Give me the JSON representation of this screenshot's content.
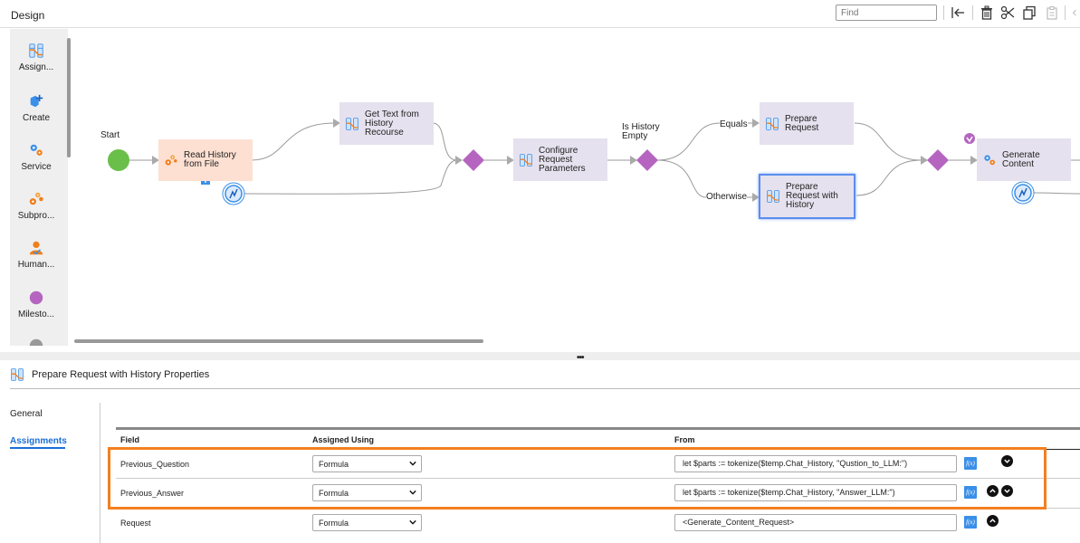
{
  "header": {
    "title": "Design",
    "find_placeholder": "Find",
    "toolbar_icons": [
      "collapse-left-icon",
      "delete-icon",
      "cut-icon",
      "copy-icon",
      "paste-icon",
      "chevron-left-icon"
    ]
  },
  "palette": {
    "items": [
      {
        "label": "Assign...",
        "icon": "assignment-icon"
      },
      {
        "label": "Create",
        "icon": "create-icon"
      },
      {
        "label": "Service",
        "icon": "service-icon"
      },
      {
        "label": "Subpro...",
        "icon": "subprocess-icon"
      },
      {
        "label": "Human...",
        "icon": "human-task-icon"
      },
      {
        "label": "Milesto...",
        "icon": "milestone-icon"
      }
    ]
  },
  "diagram": {
    "start_label": "Start",
    "nodes": {
      "read_history": "Read History from File",
      "get_text": "Get Text from History Recourse",
      "configure": "Configure Request Parameters",
      "prepare_request": "Prepare Request",
      "prepare_with_history": "Prepare Request with History",
      "generate_content": "Generate Content"
    },
    "decision_label": "Is History Empty",
    "branch_equals": "Equals",
    "branch_otherwise": "Otherwise",
    "colors": {
      "start": "#6abf4b",
      "gateway": "#b565c0",
      "assignment_node": "#e6e1ee",
      "service_node": "#fde0d2",
      "selected_border": "#5b8def"
    }
  },
  "properties": {
    "title": "Prepare Request with History Properties",
    "tabs": [
      {
        "label": "General",
        "active": false
      },
      {
        "label": "Assignments",
        "active": true
      }
    ],
    "columns": [
      "Field",
      "Assigned Using",
      "From"
    ],
    "rows": [
      {
        "field": "Previous_Question",
        "assigned_using": "Formula",
        "from": "let $parts := tokenize($temp.Chat_History, \"Qustion_to_LLM:\")",
        "move_up": false,
        "move_down": true
      },
      {
        "field": "Previous_Answer",
        "assigned_using": "Formula",
        "from": "let $parts := tokenize($temp.Chat_History, \"Answer_LLM:\")",
        "move_up": true,
        "move_down": true
      },
      {
        "field": "Request",
        "assigned_using": "Formula",
        "from": "<Generate_Content_Request>",
        "move_up": true,
        "move_down": false
      }
    ],
    "fx_label": "f(x)",
    "highlight_color": "#f47f20"
  }
}
